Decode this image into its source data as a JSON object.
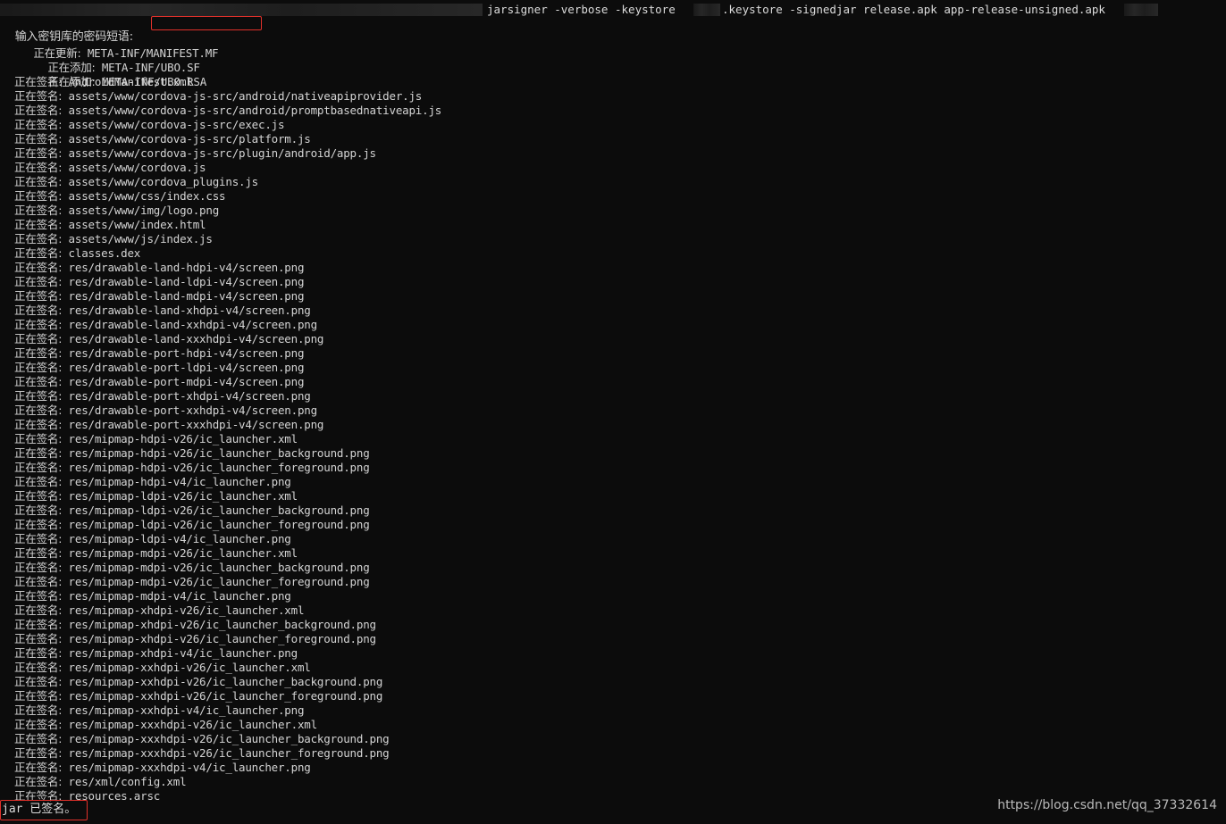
{
  "terminal": {
    "command": {
      "prefix_text": "jarsigner -verbose -keystore",
      "suffix_text": ".keystore -signedjar release.apk app-release-unsigned.apk"
    },
    "prompt": {
      "label": "输入密钥库的密码短语:"
    },
    "updating": {
      "label": "正在更新:",
      "path": "META-INF/MANIFEST.MF"
    },
    "adding": [
      {
        "label": "正在添加:",
        "path": "META-INF/UBO.SF"
      },
      {
        "label": "正在添加:",
        "path": "META-INF/UBO.RSA"
      }
    ],
    "signing_label": "正在签名:",
    "signing": [
      "AndroidManifest.xml",
      "assets/www/cordova-js-src/android/nativeapiprovider.js",
      "assets/www/cordova-js-src/android/promptbasednativeapi.js",
      "assets/www/cordova-js-src/exec.js",
      "assets/www/cordova-js-src/platform.js",
      "assets/www/cordova-js-src/plugin/android/app.js",
      "assets/www/cordova.js",
      "assets/www/cordova_plugins.js",
      "assets/www/css/index.css",
      "assets/www/img/logo.png",
      "assets/www/index.html",
      "assets/www/js/index.js",
      "classes.dex",
      "res/drawable-land-hdpi-v4/screen.png",
      "res/drawable-land-ldpi-v4/screen.png",
      "res/drawable-land-mdpi-v4/screen.png",
      "res/drawable-land-xhdpi-v4/screen.png",
      "res/drawable-land-xxhdpi-v4/screen.png",
      "res/drawable-land-xxxhdpi-v4/screen.png",
      "res/drawable-port-hdpi-v4/screen.png",
      "res/drawable-port-ldpi-v4/screen.png",
      "res/drawable-port-mdpi-v4/screen.png",
      "res/drawable-port-xhdpi-v4/screen.png",
      "res/drawable-port-xxhdpi-v4/screen.png",
      "res/drawable-port-xxxhdpi-v4/screen.png",
      "res/mipmap-hdpi-v26/ic_launcher.xml",
      "res/mipmap-hdpi-v26/ic_launcher_background.png",
      "res/mipmap-hdpi-v26/ic_launcher_foreground.png",
      "res/mipmap-hdpi-v4/ic_launcher.png",
      "res/mipmap-ldpi-v26/ic_launcher.xml",
      "res/mipmap-ldpi-v26/ic_launcher_background.png",
      "res/mipmap-ldpi-v26/ic_launcher_foreground.png",
      "res/mipmap-ldpi-v4/ic_launcher.png",
      "res/mipmap-mdpi-v26/ic_launcher.xml",
      "res/mipmap-mdpi-v26/ic_launcher_background.png",
      "res/mipmap-mdpi-v26/ic_launcher_foreground.png",
      "res/mipmap-mdpi-v4/ic_launcher.png",
      "res/mipmap-xhdpi-v26/ic_launcher.xml",
      "res/mipmap-xhdpi-v26/ic_launcher_background.png",
      "res/mipmap-xhdpi-v26/ic_launcher_foreground.png",
      "res/mipmap-xhdpi-v4/ic_launcher.png",
      "res/mipmap-xxhdpi-v26/ic_launcher.xml",
      "res/mipmap-xxhdpi-v26/ic_launcher_background.png",
      "res/mipmap-xxhdpi-v26/ic_launcher_foreground.png",
      "res/mipmap-xxhdpi-v4/ic_launcher.png",
      "res/mipmap-xxxhdpi-v26/ic_launcher.xml",
      "res/mipmap-xxxhdpi-v26/ic_launcher_background.png",
      "res/mipmap-xxxhdpi-v26/ic_launcher_foreground.png",
      "res/mipmap-xxxhdpi-v4/ic_launcher.png",
      "res/xml/config.xml",
      "resources.arsc"
    ],
    "result": "jar 已签名。",
    "watermark": "https://blog.csdn.net/qq_37332614",
    "colors": {
      "background": "#0c0c0c",
      "text": "#d4d4d4",
      "highlight_box": "#e0302a"
    }
  }
}
